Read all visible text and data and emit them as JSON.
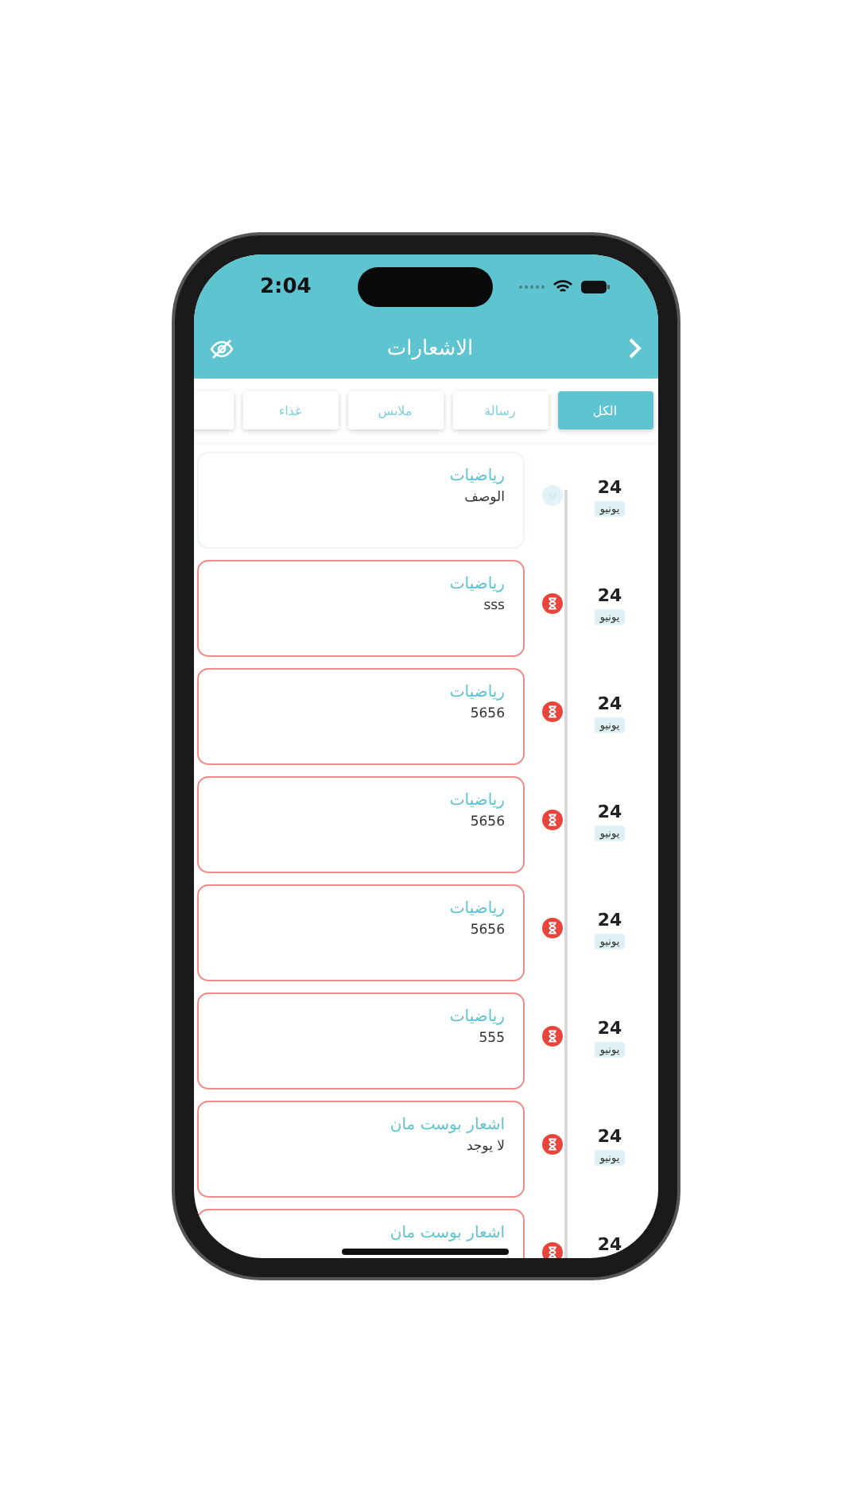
{
  "status_bar": {
    "time": "2:04"
  },
  "header": {
    "title": "الاشعارات"
  },
  "tabs": [
    {
      "label": "الكل",
      "selected": true
    },
    {
      "label": "رسالة",
      "selected": false
    },
    {
      "label": "ملابس",
      "selected": false
    },
    {
      "label": "غذاء",
      "selected": false
    }
  ],
  "notifications": [
    {
      "day": "24",
      "month": "يونيو",
      "title": "رياضيات",
      "description": "الوصف",
      "overdue": false
    },
    {
      "day": "24",
      "month": "يونيو",
      "title": "رياضيات",
      "description": "sss",
      "overdue": true
    },
    {
      "day": "24",
      "month": "يونيو",
      "title": "رياضيات",
      "description": "5656",
      "overdue": true
    },
    {
      "day": "24",
      "month": "يونيو",
      "title": "رياضيات",
      "description": "5656",
      "overdue": true
    },
    {
      "day": "24",
      "month": "يونيو",
      "title": "رياضيات",
      "description": "5656",
      "overdue": true
    },
    {
      "day": "24",
      "month": "يونيو",
      "title": "رياضيات",
      "description": "555",
      "overdue": true
    },
    {
      "day": "24",
      "month": "يونيو",
      "title": "اشعار بوست مان",
      "description": "لا يوجد",
      "overdue": true
    },
    {
      "day": "24",
      "title": "اشعار بوست مان",
      "overdue": true
    }
  ]
}
